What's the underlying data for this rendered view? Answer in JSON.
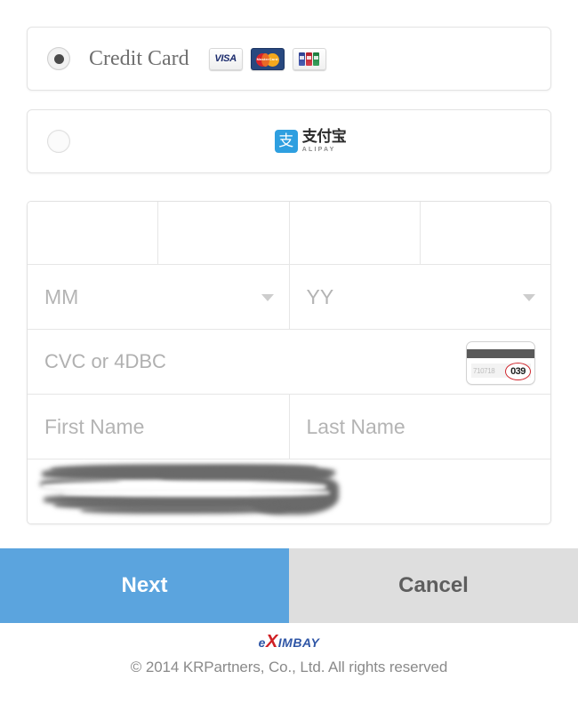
{
  "payment_methods": [
    {
      "id": "credit-card",
      "label": "Credit Card",
      "selected": true,
      "card_brands": [
        "VISA",
        "MasterCard",
        "JCB"
      ],
      "mastercard_wordmark": "MasterCard"
    },
    {
      "id": "alipay",
      "label": "",
      "selected": false,
      "logo_mark": "支",
      "logo_cn": "支付宝",
      "logo_en": "ALIPAY"
    }
  ],
  "form": {
    "card_number": {
      "segments": [
        "",
        "",
        "",
        ""
      ],
      "placeholders": [
        "",
        "",
        "",
        ""
      ]
    },
    "expiry": {
      "month": {
        "value": "",
        "placeholder": "MM"
      },
      "year": {
        "value": "",
        "placeholder": "YY"
      }
    },
    "cvc": {
      "placeholder": "CVC or 4DBC",
      "value": "",
      "hint_card": {
        "signature_digits": "710718",
        "cvc_digits": "039",
        "highlight_color": "#d0282f"
      }
    },
    "name": {
      "first": {
        "value": "",
        "placeholder": "First Name"
      },
      "last": {
        "value": "",
        "placeholder": "Last Name"
      }
    },
    "redacted_row": {
      "label": "",
      "redacted": true
    }
  },
  "actions": {
    "next_label": "Next",
    "cancel_label": "Cancel",
    "next_color": "#5ba4de",
    "cancel_color": "#dedede"
  },
  "footer": {
    "brand_e": "e",
    "brand_x": "X",
    "brand_rest": "IMBAY",
    "brand_blue": "#2f56a6",
    "brand_red": "#d02024",
    "copyright": "© 2014 KRPartners, Co., Ltd. All rights reserved"
  }
}
